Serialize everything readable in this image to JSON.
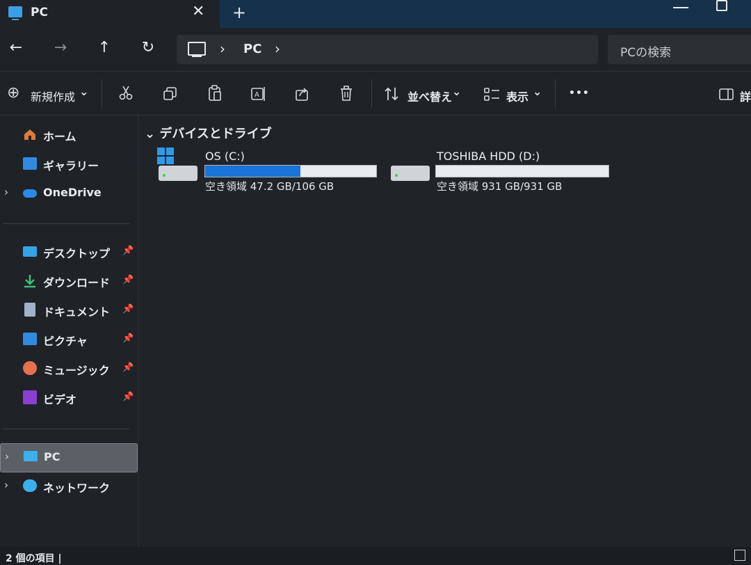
{
  "window": {
    "tab_title": "PC",
    "close_glyph": "✕",
    "new_tab_glyph": "+"
  },
  "navigation": {
    "back": "←",
    "forward": "→",
    "up": "↑",
    "refresh": "↻"
  },
  "address": {
    "sep": "›",
    "crumb": "PC"
  },
  "search": {
    "placeholder": "PCの検索"
  },
  "commandbar": {
    "new_label": "新規作成",
    "new_icon": "⊕",
    "chevron": "⌄",
    "sort_label": "並べ替え",
    "view_label": "表示",
    "more": "•••",
    "details_label": "詳"
  },
  "sidebar": {
    "items": [
      {
        "label": "ホーム",
        "icon": "home-icon"
      },
      {
        "label": "ギャラリー",
        "icon": "gallery-icon"
      },
      {
        "label": "OneDrive",
        "icon": "cloud-icon"
      },
      {
        "label": "デスクトップ",
        "icon": "desktop-icon"
      },
      {
        "label": "ダウンロード",
        "icon": "download-icon"
      },
      {
        "label": "ドキュメント",
        "icon": "document-icon"
      },
      {
        "label": "ピクチャ",
        "icon": "pictures-icon"
      },
      {
        "label": "ミュージック",
        "icon": "music-icon"
      },
      {
        "label": "ビデオ",
        "icon": "video-icon"
      },
      {
        "label": "PC",
        "icon": "pc-icon"
      },
      {
        "label": "ネットワーク",
        "icon": "network-icon"
      }
    ],
    "chevron": "›",
    "pin": "📌"
  },
  "main": {
    "group_header": "⌄ デバイスとドライブ",
    "drives": [
      {
        "name": "OS (C:)",
        "free_text": "空き領域 47.2 GB/106 GB",
        "used_fraction": 0.555
      },
      {
        "name": "TOSHIBA HDD (D:)",
        "free_text": "空き領域 931 GB/931 GB",
        "used_fraction": 0.0
      }
    ]
  },
  "status": {
    "text": "2 個の項目  |"
  },
  "colors": {
    "accent": "#1a73d8",
    "titlebar": "#15324a",
    "background": "#1c2024"
  }
}
